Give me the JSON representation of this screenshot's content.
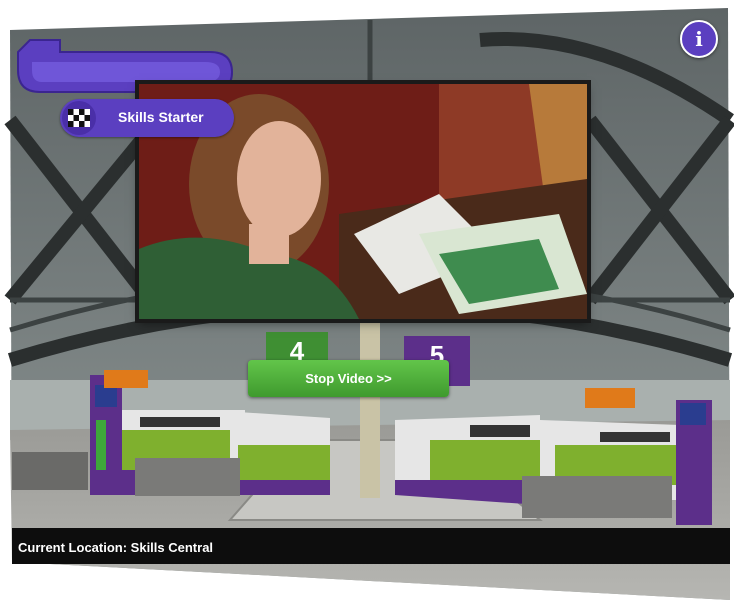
{
  "hud": {
    "badge_label": "Skills Starter",
    "info_button_label": "i",
    "stop_video_label": "Stop Video >>",
    "location_text": "Current Location: Skills Central"
  },
  "scene": {
    "platform_numbers": [
      "4",
      "5"
    ]
  },
  "icons": {
    "back": "back-arrow-icon",
    "badge": "checkered-flag-icon",
    "info": "info-icon"
  },
  "colors": {
    "accent_purple": "#5b3fc0",
    "button_green": "#4caf3a",
    "train_purple": "#5c2f8a",
    "train_green": "#7fb02e"
  }
}
